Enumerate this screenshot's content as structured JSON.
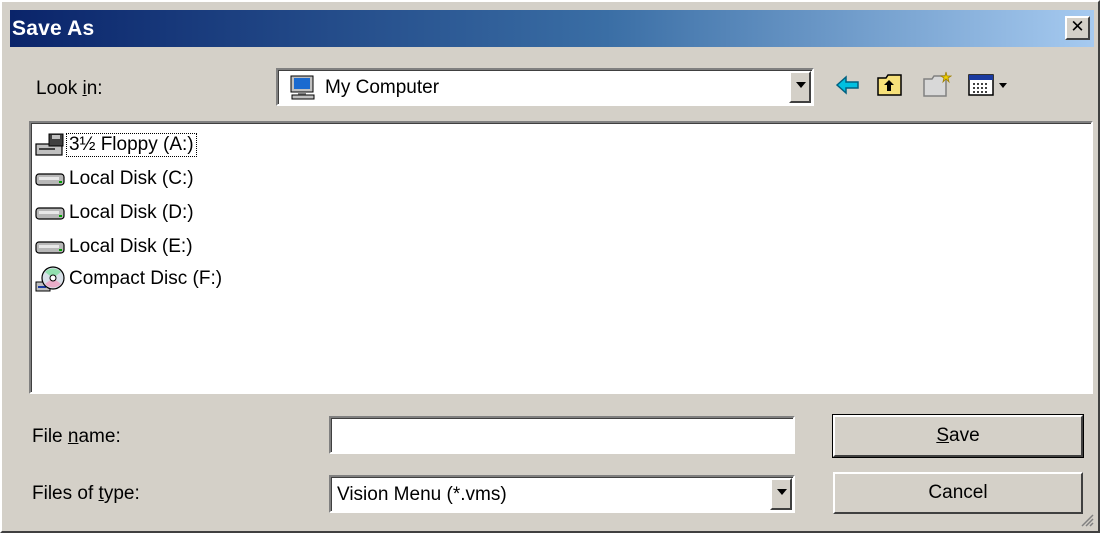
{
  "window": {
    "title": "Save As",
    "close_label": "✕"
  },
  "look_in": {
    "label_pre": "Look ",
    "label_key": "i",
    "label_post": "n:",
    "value": "My Computer",
    "value_icon": "computer-icon"
  },
  "toolbar": {
    "icons": [
      "back-arrow-icon",
      "up-folder-icon",
      "new-folder-icon",
      "view-menu-icon"
    ]
  },
  "files": [
    {
      "name": "3½ Floppy (A:)",
      "icon": "floppy-drive-icon",
      "focused": true
    },
    {
      "name": "Local Disk (C:)",
      "icon": "hard-disk-icon",
      "focused": false
    },
    {
      "name": "Local Disk (D:)",
      "icon": "hard-disk-icon",
      "focused": false
    },
    {
      "name": "Local Disk (E:)",
      "icon": "hard-disk-icon",
      "focused": false
    },
    {
      "name": "Compact Disc (F:)",
      "icon": "cd-drive-icon",
      "focused": false
    }
  ],
  "file_name": {
    "label_pre": "File ",
    "label_key": "n",
    "label_post": "ame:",
    "value": ""
  },
  "file_type": {
    "label_pre": "Files of ",
    "label_key": "t",
    "label_post": "ype:",
    "value": "Vision Menu (*.vms)"
  },
  "buttons": {
    "save_key": "S",
    "save_rest": "ave",
    "cancel": "Cancel"
  },
  "colors": {
    "face": "#d4d0c8",
    "title_start": "#0a246a",
    "title_end": "#a6caf0"
  }
}
